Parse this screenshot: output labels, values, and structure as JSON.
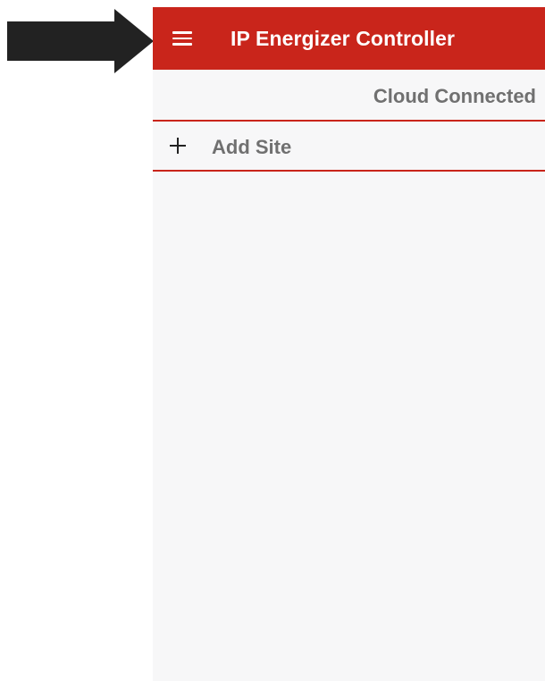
{
  "annotation": {
    "pointer_icon": "right-arrow-icon",
    "pointer_color": "#222222"
  },
  "app_bar": {
    "title": "IP Energizer Controller",
    "menu_icon": "hamburger-menu-icon",
    "background_color": "#c9251b"
  },
  "status": {
    "text": "Cloud Connected"
  },
  "sites": {
    "add_icon": "plus-icon",
    "add_label": "Add Site"
  },
  "colors": {
    "accent": "#c9251b",
    "muted_text": "#707070",
    "screen_background": "#f7f7f8"
  }
}
